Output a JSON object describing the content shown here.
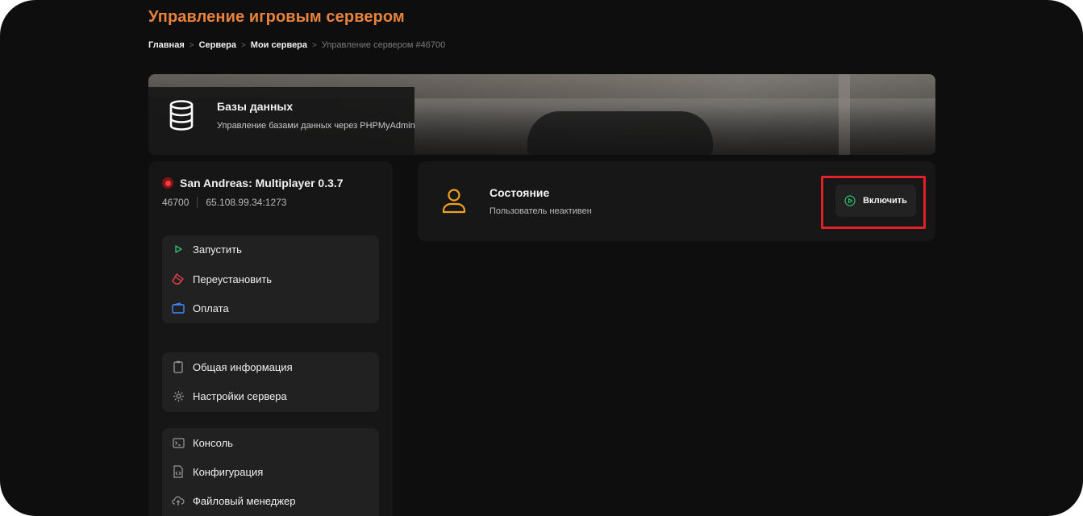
{
  "header": {
    "title": "Управление игровым сервером",
    "breadcrumb": [
      "Главная",
      "Сервера",
      "Мои сервера",
      "Управление сервером #46700"
    ],
    "separator": ">"
  },
  "banner": {
    "title": "Базы данных",
    "subtitle": "Управление базами данных через PHPMyAdmin",
    "icon": "database-icon"
  },
  "server": {
    "name": "San Andreas: Multiplayer 0.3.7",
    "id": "46700",
    "address": "65.108.99.34:1273",
    "status_color": "#ff3b3b"
  },
  "menu": {
    "actions": [
      {
        "label": "Запустить",
        "icon": "play-icon",
        "color": "#2fbf6a"
      },
      {
        "label": "Переустановить",
        "icon": "eraser-icon",
        "color": "#e8404d"
      },
      {
        "label": "Оплата",
        "icon": "wallet-icon",
        "color": "#3d8bff"
      }
    ],
    "info": [
      {
        "label": "Общая информация",
        "icon": "clipboard-icon"
      },
      {
        "label": "Настройки сервера",
        "icon": "gear-icon"
      }
    ],
    "tools": [
      {
        "label": "Консоль",
        "icon": "terminal-icon"
      },
      {
        "label": "Конфигурация",
        "icon": "code-file-icon"
      },
      {
        "label": "Файловый менеджер",
        "icon": "cloud-upload-icon"
      }
    ]
  },
  "state": {
    "title": "Состояние",
    "subtitle": "Пользователь неактивен",
    "icon": "user-icon",
    "accent": "#f0a020",
    "button_label": "Включить",
    "button_icon_color": "#2fbf6a",
    "highlight_color": "#e3202a"
  }
}
